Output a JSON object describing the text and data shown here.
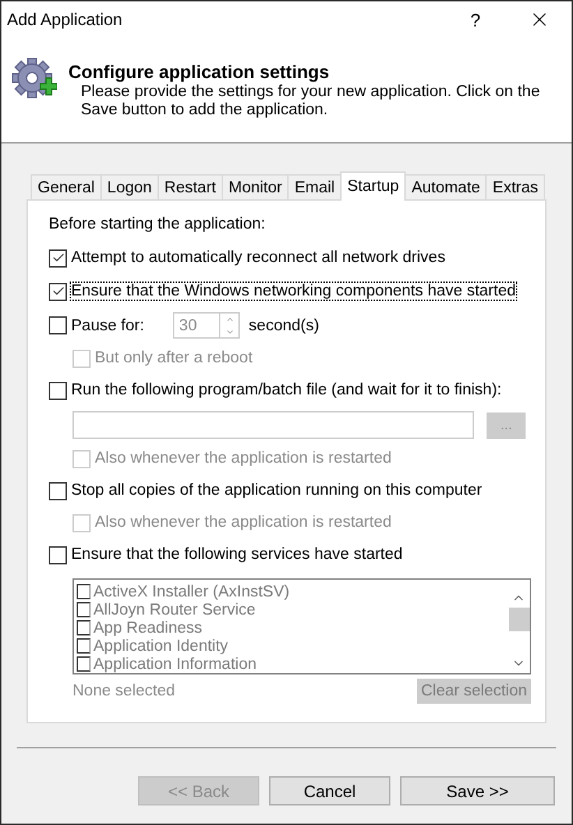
{
  "window": {
    "title": "Add Application",
    "help": "?"
  },
  "header": {
    "title": "Configure application settings",
    "description": "Please provide the settings for your new application. Click on the Save button to add the application."
  },
  "tabs": [
    {
      "label": "General",
      "selected": false
    },
    {
      "label": "Logon",
      "selected": false
    },
    {
      "label": "Restart",
      "selected": false
    },
    {
      "label": "Monitor",
      "selected": false
    },
    {
      "label": "Email",
      "selected": false
    },
    {
      "label": "Startup",
      "selected": true
    },
    {
      "label": "Automate",
      "selected": false
    },
    {
      "label": "Extras",
      "selected": false
    }
  ],
  "heading": "Before starting the application:",
  "options": [
    {
      "kind": "check",
      "label": "Attempt to automatically reconnect all network drives",
      "checked": true,
      "focused": false,
      "disabled": false
    },
    {
      "kind": "check",
      "label": "Ensure that the Windows networking components have started",
      "checked": true,
      "focused": true,
      "disabled": false
    },
    {
      "kind": "pause",
      "label": "Pause for:",
      "checked": false,
      "value": "30",
      "unit": "second(s)"
    },
    {
      "kind": "subcheck",
      "label": "But only after a reboot",
      "checked": false,
      "focused": false,
      "disabled": true
    },
    {
      "kind": "check",
      "label": "Run the following program/batch file (and wait for it to finish):",
      "checked": false,
      "focused": false,
      "disabled": false
    },
    {
      "kind": "file",
      "browse": "...",
      "disabled": true
    },
    {
      "kind": "subcheck",
      "label": "Also whenever the application is restarted",
      "checked": false,
      "focused": false,
      "disabled": true
    },
    {
      "kind": "check",
      "label": "Stop all copies of the application running on this computer",
      "checked": false,
      "focused": false,
      "disabled": false
    },
    {
      "kind": "subcheck",
      "label": "Also whenever the application is restarted",
      "checked": false,
      "focused": false,
      "disabled": true
    },
    {
      "kind": "check",
      "label": "Ensure that the following services have started",
      "checked": false,
      "focused": false,
      "disabled": false
    },
    {
      "kind": "services",
      "disabled": true,
      "status": "None selected",
      "clear": "Clear selection",
      "items": [
        {
          "label": "ActiveX Installer (AxInstSV)",
          "checked": false
        },
        {
          "label": "AllJoyn Router Service",
          "checked": false
        },
        {
          "label": "App Readiness",
          "checked": false
        },
        {
          "label": "Application Identity",
          "checked": false
        },
        {
          "label": "Application Information",
          "checked": false
        }
      ]
    }
  ],
  "buttons": [
    {
      "label": "<< Back",
      "disabled": true
    },
    {
      "label": "Cancel",
      "disabled": false
    },
    {
      "label": "Save >>",
      "disabled": false
    }
  ]
}
